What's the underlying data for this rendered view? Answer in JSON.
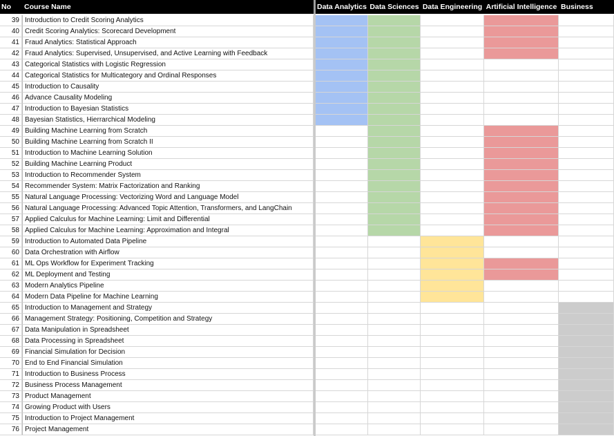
{
  "headers": {
    "no": "No",
    "course_name": "Course Name",
    "categories": [
      "Data Analytics",
      "Data Sciences",
      "Data Engineering",
      "Artificial Intelligence",
      "Business"
    ]
  },
  "colors": {
    "data_analytics": "#a4c2f4",
    "data_sciences": "#b6d7a8",
    "data_engineering": "#ffe599",
    "artificial_intelligence": "#ea9999",
    "business": "#cccccc"
  },
  "courses": [
    {
      "no": "39",
      "name": "Introduction to Credit Scoring Analytics",
      "tags": [
        1,
        1,
        0,
        1,
        0
      ]
    },
    {
      "no": "40",
      "name": "Credit Scoring Analytics: Scorecard Development",
      "tags": [
        1,
        1,
        0,
        1,
        0
      ]
    },
    {
      "no": "41",
      "name": "Fraud Analytics: Statistical Approach",
      "tags": [
        1,
        1,
        0,
        1,
        0
      ]
    },
    {
      "no": "42",
      "name": "Fraud Analytics: Supervised, Unsupervised, and Active Learning with Feedback",
      "tags": [
        1,
        1,
        0,
        1,
        0
      ]
    },
    {
      "no": "43",
      "name": "Categorical Statistics with Logistic Regression",
      "tags": [
        1,
        1,
        0,
        0,
        0
      ]
    },
    {
      "no": "44",
      "name": "Categorical Statistics for Multicategory and Ordinal Responses",
      "tags": [
        1,
        1,
        0,
        0,
        0
      ]
    },
    {
      "no": "45",
      "name": "Introduction to Causality",
      "tags": [
        1,
        1,
        0,
        0,
        0
      ]
    },
    {
      "no": "46",
      "name": "Advance Causality Modeling",
      "tags": [
        1,
        1,
        0,
        0,
        0
      ]
    },
    {
      "no": "47",
      "name": "Introduction to Bayesian Statistics",
      "tags": [
        1,
        1,
        0,
        0,
        0
      ]
    },
    {
      "no": "48",
      "name": "Bayesian Statistics, Hierrarchical Modeling",
      "tags": [
        1,
        1,
        0,
        0,
        0
      ]
    },
    {
      "no": "49",
      "name": "Building Machine Learning from Scratch",
      "tags": [
        0,
        1,
        0,
        1,
        0
      ]
    },
    {
      "no": "50",
      "name": "Building Machine Learning from Scratch II",
      "tags": [
        0,
        1,
        0,
        1,
        0
      ]
    },
    {
      "no": "51",
      "name": "Introduction to Machine Learning Solution",
      "tags": [
        0,
        1,
        0,
        1,
        0
      ]
    },
    {
      "no": "52",
      "name": "Building Machine Learning Product",
      "tags": [
        0,
        1,
        0,
        1,
        0
      ]
    },
    {
      "no": "53",
      "name": "Introduction to Recommender System",
      "tags": [
        0,
        1,
        0,
        1,
        0
      ]
    },
    {
      "no": "54",
      "name": "Recommender System: Matrix Factorization and Ranking",
      "tags": [
        0,
        1,
        0,
        1,
        0
      ]
    },
    {
      "no": "55",
      "name": "Natural Language Processing: Vectorizing Word and Language Model",
      "tags": [
        0,
        1,
        0,
        1,
        0
      ]
    },
    {
      "no": "56",
      "name": "Natural Language Processing: Advanced Topic Attention, Transformers, and LangChain",
      "tags": [
        0,
        1,
        0,
        1,
        0
      ]
    },
    {
      "no": "57",
      "name": "Applied Calculus for Machine Learning: Limit and Differential",
      "tags": [
        0,
        1,
        0,
        1,
        0
      ]
    },
    {
      "no": "58",
      "name": "Applied Calculus for Machine Learning: Approximation and Integral",
      "tags": [
        0,
        1,
        0,
        1,
        0
      ]
    },
    {
      "no": "59",
      "name": "Introduction to Automated Data Pipeline",
      "tags": [
        0,
        0,
        1,
        0,
        0
      ]
    },
    {
      "no": "60",
      "name": "Data Orchestration with Airflow",
      "tags": [
        0,
        0,
        1,
        0,
        0
      ]
    },
    {
      "no": "61",
      "name": "ML Ops Workflow for Experiment Tracking",
      "tags": [
        0,
        0,
        1,
        1,
        0
      ]
    },
    {
      "no": "62",
      "name": "ML Deployment and Testing",
      "tags": [
        0,
        0,
        1,
        1,
        0
      ]
    },
    {
      "no": "63",
      "name": "Modern Analytics Pipeline",
      "tags": [
        0,
        0,
        1,
        0,
        0
      ]
    },
    {
      "no": "64",
      "name": "Modern Data Pipeline for Machine Learning",
      "tags": [
        0,
        0,
        1,
        0,
        0
      ]
    },
    {
      "no": "65",
      "name": "Introduction to Management and Strategy",
      "tags": [
        0,
        0,
        0,
        0,
        1
      ]
    },
    {
      "no": "66",
      "name": "Management Strategy: Positioning, Competition and Strategy",
      "tags": [
        0,
        0,
        0,
        0,
        1
      ]
    },
    {
      "no": "67",
      "name": "Data Manipulation in Spreadsheet",
      "tags": [
        0,
        0,
        0,
        0,
        1
      ]
    },
    {
      "no": "68",
      "name": "Data Processing in Spreadsheet",
      "tags": [
        0,
        0,
        0,
        0,
        1
      ]
    },
    {
      "no": "69",
      "name": "Financial Simulation for Decision",
      "tags": [
        0,
        0,
        0,
        0,
        1
      ]
    },
    {
      "no": "70",
      "name": "End to End Financial Simulation",
      "tags": [
        0,
        0,
        0,
        0,
        1
      ]
    },
    {
      "no": "71",
      "name": "Introduction to Business Process",
      "tags": [
        0,
        0,
        0,
        0,
        1
      ]
    },
    {
      "no": "72",
      "name": "Business Process Management",
      "tags": [
        0,
        0,
        0,
        0,
        1
      ]
    },
    {
      "no": "73",
      "name": "Product Management",
      "tags": [
        0,
        0,
        0,
        0,
        1
      ]
    },
    {
      "no": "74",
      "name": "Growing Product with Users",
      "tags": [
        0,
        0,
        0,
        0,
        1
      ]
    },
    {
      "no": "75",
      "name": "Introduction to Project Management",
      "tags": [
        0,
        0,
        0,
        0,
        1
      ]
    },
    {
      "no": "76",
      "name": "Project Management",
      "tags": [
        0,
        0,
        0,
        0,
        1
      ]
    }
  ]
}
